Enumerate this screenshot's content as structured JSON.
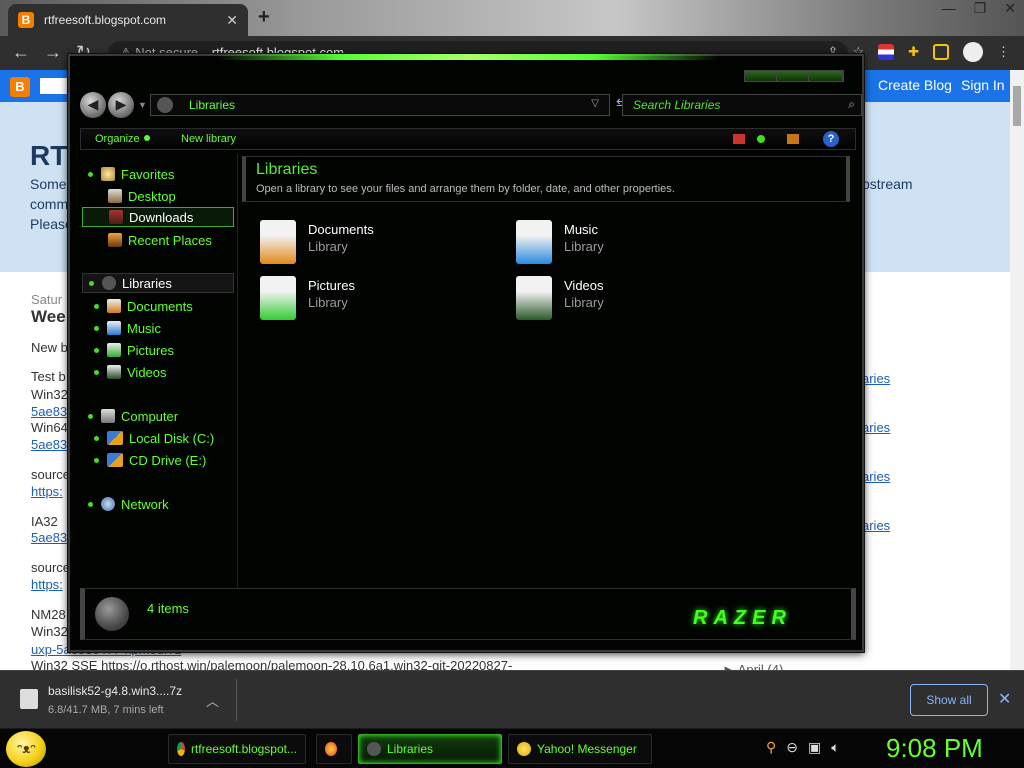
{
  "browser": {
    "tab_title": "rtfreesoft.blogspot.com",
    "tab_favicon": "B",
    "tab_close": "✕",
    "new_tab": "+",
    "window_controls": [
      "—",
      "❐",
      "✕"
    ],
    "security_label": "Not secure",
    "url": "rtfreesoft.blogspot.com"
  },
  "blog": {
    "logo": "B",
    "create_blog": "Create Blog",
    "sign_in": "Sign In",
    "title": "RT",
    "desc_lines": [
      "Some",
      "comm",
      "Please"
    ],
    "desc_right": "pstream",
    "date": "Satur",
    "post_heading": "Wee",
    "post_lines": [
      {
        "text": "New b",
        "kind": "text"
      },
      {
        "text": "Test b",
        "kind": "text"
      },
      {
        "text": "Win32",
        "kind": "text"
      },
      {
        "text": "5ae83",
        "kind": "link"
      },
      {
        "text": "Win64",
        "kind": "text"
      },
      {
        "text": "5ae83",
        "kind": "link"
      },
      {
        "text": "source",
        "kind": "text"
      },
      {
        "text": "https:",
        "kind": "link"
      },
      {
        "text": "IA32",
        "kind": "text"
      },
      {
        "text": "5ae83",
        "kind": "link"
      },
      {
        "text": "source",
        "kind": "text"
      },
      {
        "text": "https:",
        "kind": "link"
      },
      {
        "text": "NM28",
        "kind": "text"
      },
      {
        "text": "Win32",
        "kind": "text"
      },
      {
        "text": "uxp-5ae83c477-xpmod.7z",
        "kind": "link"
      },
      {
        "text": "Win32 SSE https://o.rthost.win/palemoon/palemoon-28.10.6a1.win32-git-20220827-",
        "kind": "text"
      }
    ],
    "side_links": [
      "aries",
      "aries",
      "aries",
      "aries"
    ],
    "archive": "► April (4)"
  },
  "download_bar": {
    "filename": "basilisk52-g4.8.win3....7z",
    "status": "6.8/41.7 MB, 7 mins left",
    "progress": 0.163,
    "show_all": "Show all",
    "close": "✕"
  },
  "explorer": {
    "address": "Libraries",
    "search_placeholder": "Search Libraries",
    "commands": {
      "organize": "Organize",
      "new_library": "New library",
      "help": "?"
    },
    "nav": {
      "favorites": "Favorites",
      "desktop": "Desktop",
      "downloads": "Downloads",
      "recent_places": "Recent Places",
      "libraries": "Libraries",
      "documents": "Documents",
      "music": "Music",
      "pictures": "Pictures",
      "videos": "Videos",
      "computer": "Computer",
      "local_disk": "Local Disk (C:)",
      "cd_drive": "CD Drive (E:)",
      "network": "Network"
    },
    "header": {
      "title": "Libraries",
      "description": "Open a library to see your files and arrange them by folder, date, and other properties."
    },
    "libraries": [
      {
        "name": "Documents",
        "type": "Library",
        "icon": "documents-library-icon",
        "color": "#e08a1a"
      },
      {
        "name": "Music",
        "type": "Library",
        "icon": "music-library-icon",
        "color": "#2a8adf"
      },
      {
        "name": "Pictures",
        "type": "Library",
        "icon": "pictures-library-icon",
        "color": "#33cc33"
      },
      {
        "name": "Videos",
        "type": "Library",
        "icon": "videos-library-icon",
        "color": "#2a5a2a"
      }
    ],
    "details": {
      "count": "4 items",
      "logo": "RAZER"
    },
    "accent_color": "#66ff33"
  },
  "taskbar": {
    "items": [
      {
        "label": "rtfreesoft.blogspot...",
        "icon": "chrome-icon"
      },
      {
        "label": "",
        "icon": "firefox-icon"
      },
      {
        "label": "Libraries",
        "icon": "libraries-icon"
      },
      {
        "label": "Yahoo! Messenger",
        "icon": "yahoo-messenger-icon"
      }
    ],
    "clock": "9:08 PM"
  }
}
